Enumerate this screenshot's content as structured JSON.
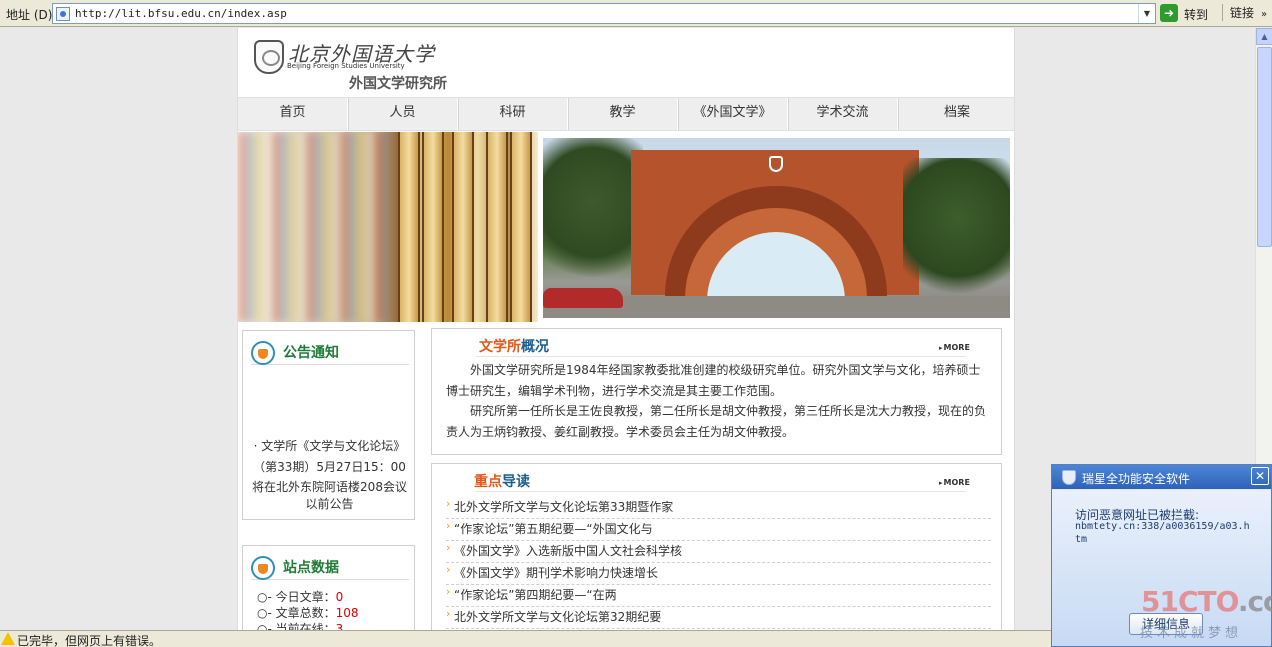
{
  "browser": {
    "address_label": "地址 (D)",
    "url": "http://lit.bfsu.edu.cn/index.asp",
    "go_label": "转到",
    "links_label": "链接",
    "status_text": "已完毕，但网页上有错误。"
  },
  "header": {
    "university_cn": "北京外国语大学",
    "university_en": "Beijing Foreign Studies University",
    "institute": "外国文学研究所"
  },
  "nav": [
    "首页",
    "人员",
    "科研",
    "教学",
    "《外国文学》",
    "学术交流",
    "档案"
  ],
  "notice": {
    "title": "公告通知",
    "lines": [
      "· 文学所《文学与文化论坛》",
      "（第33期）5月27日15：00",
      "将在北外东院阿语楼208会议",
      "以前公告"
    ]
  },
  "stats": {
    "title": "站点数据",
    "rows": [
      {
        "label": "○- 今日文章：",
        "value": "0"
      },
      {
        "label": "○- 文章总数：",
        "value": "108"
      },
      {
        "label": "○- 当前在线：",
        "value": "3"
      }
    ]
  },
  "intro": {
    "title_a": "文学所",
    "title_b": "概况",
    "more": "MORE",
    "p1": "外国文学研究所是1984年经国家教委批准创建的校级研究单位。研究外国文学与文化，培养硕士博士研究生，编辑学术刊物，进行学术交流是其主要工作范围。",
    "p2": "研究所第一任所长是王佐良教授，第二任所长是胡文仲教授，第三任所长是沈大力教授，现在的负责人为王炳钧教授、姜红副教授。学术委员会主任为胡文仲教授。"
  },
  "reading": {
    "title_a": "重点",
    "title_b": "导读",
    "more": "MORE",
    "items": [
      "北外文学所文学与文化论坛第33期暨作家",
      "“作家论坛”第五期纪要—“外国文化与",
      "《外国文学》入选新版中国人文社会科学核",
      "《外国文学》期刊学术影响力快速增长",
      "“作家论坛”第四期纪要—“在两",
      "北外文学所文学与文化论坛第32期纪要"
    ]
  },
  "popup": {
    "title": "瑞星全功能安全软件",
    "message": "访问恶意网址已被拦截:",
    "blocked_url": "nbmtety.cn:338/a0036159/a03.htm",
    "button": "详细信息"
  },
  "watermark": {
    "main": "51CTO",
    "suffix": ".com",
    "sub": "技术成就梦想"
  }
}
